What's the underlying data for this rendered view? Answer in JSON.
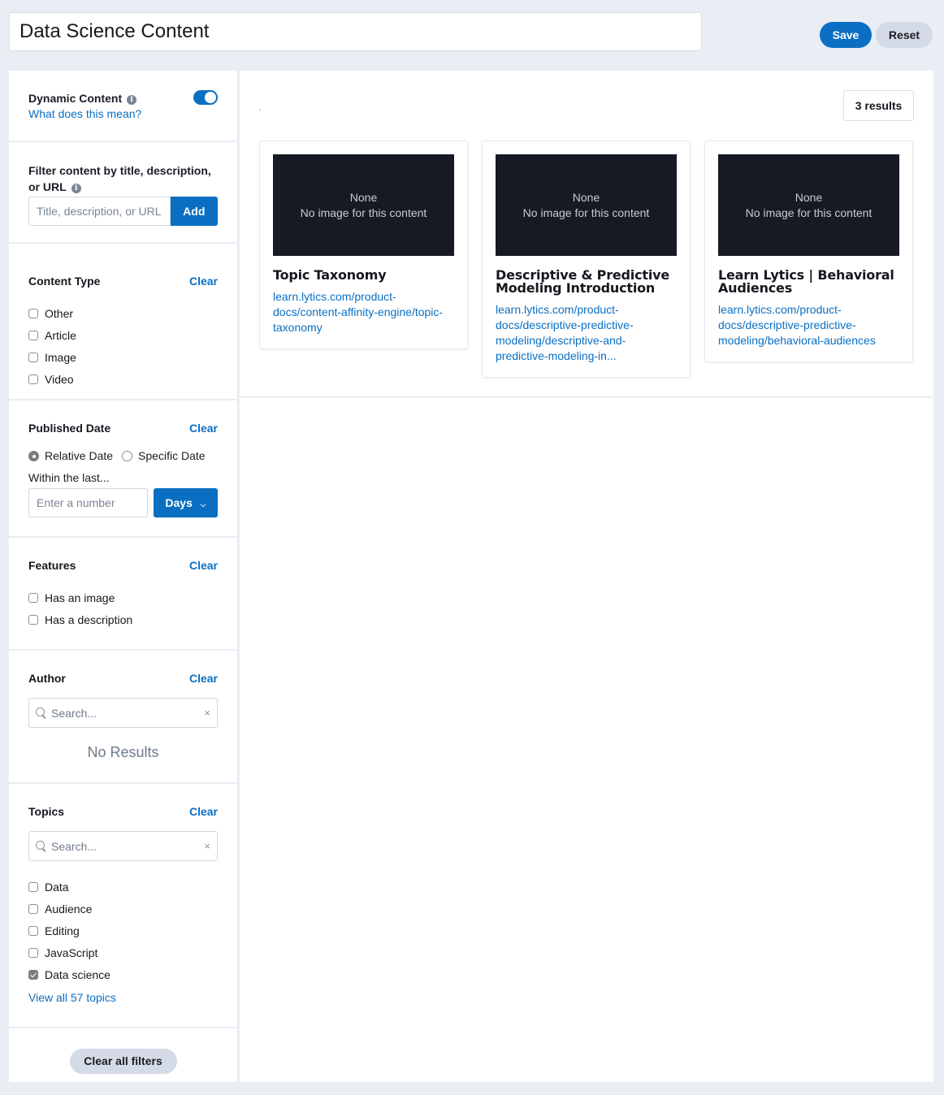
{
  "header": {
    "title_value": "Data Science Content",
    "save_label": "Save",
    "reset_label": "Reset"
  },
  "sidebar": {
    "dynamic": {
      "label": "Dynamic Content",
      "info_icon": "i",
      "help_link": "What does this mean?",
      "enabled": true
    },
    "text_filter": {
      "label": "Filter content by title, description, or URL",
      "info_icon": "i",
      "placeholder": "Title, description, or URL",
      "add_label": "Add"
    },
    "content_type": {
      "title": "Content Type",
      "clear_label": "Clear",
      "options": [
        {
          "label": "Other",
          "checked": false
        },
        {
          "label": "Article",
          "checked": false
        },
        {
          "label": "Image",
          "checked": false
        },
        {
          "label": "Video",
          "checked": false
        }
      ]
    },
    "published_date": {
      "title": "Published Date",
      "clear_label": "Clear",
      "relative_label": "Relative Date",
      "specific_label": "Specific Date",
      "selected": "relative",
      "within_label": "Within the last...",
      "number_placeholder": "Enter a number",
      "unit_label": "Days",
      "unit_icon": "chevron-down"
    },
    "features": {
      "title": "Features",
      "clear_label": "Clear",
      "options": [
        {
          "label": "Has an image",
          "checked": false
        },
        {
          "label": "Has a description",
          "checked": false
        }
      ]
    },
    "author": {
      "title": "Author",
      "clear_label": "Clear",
      "search_placeholder": "Search...",
      "clear_icon": "×",
      "empty_text": "No Results"
    },
    "topics": {
      "title": "Topics",
      "clear_label": "Clear",
      "search_placeholder": "Search...",
      "clear_icon": "×",
      "options": [
        {
          "label": "Data",
          "checked": false
        },
        {
          "label": "Audience",
          "checked": false
        },
        {
          "label": "Editing",
          "checked": false
        },
        {
          "label": "JavaScript",
          "checked": false
        },
        {
          "label": "Data science",
          "checked": true
        }
      ],
      "view_all_label": "View all 57 topics"
    },
    "clear_all_label": "Clear all filters"
  },
  "main": {
    "results_label": "3 results",
    "cards": [
      {
        "image_line1": "None",
        "image_line2": "No image for this content",
        "title": "Topic Taxonomy",
        "url": "learn.lytics.com/product-docs/content-affinity-engine/topic-taxonomy"
      },
      {
        "image_line1": "None",
        "image_line2": "No image for this content",
        "title": "Descriptive & Predictive Modeling Introduction",
        "url": "learn.lytics.com/product-docs/descriptive-predictive-modeling/descriptive-and-predictive-modeling-in..."
      },
      {
        "image_line1": "None",
        "image_line2": "No image for this content",
        "title": "Learn Lytics | Behavioral Audiences",
        "url": "learn.lytics.com/product-docs/descriptive-predictive-modeling/behavioral-audiences"
      }
    ]
  }
}
